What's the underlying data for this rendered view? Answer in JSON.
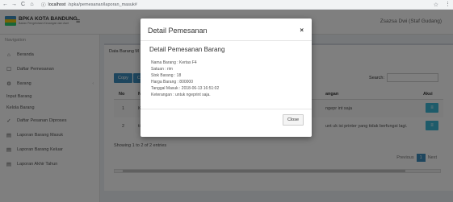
{
  "browser": {
    "url_host": "localhost",
    "url_path": "/spka/pemesanan/laporan_masuk#"
  },
  "header": {
    "logo_title": "BPKA KOTA BANDUNG",
    "logo_subtitle": "Badan Pengelolaan Keuangan dan Aset",
    "user": "Zsazsa Dwi (Staf Gudang)"
  },
  "sidebar": {
    "header": "Navigation",
    "items": [
      {
        "label": "Beranda",
        "icon": "home-icon"
      },
      {
        "label": "Daftar Pemesanan",
        "icon": "list-icon"
      },
      {
        "label": "Barang",
        "icon": "box-icon"
      }
    ],
    "sub_items": [
      "Input Barang",
      "Kelola Barang"
    ],
    "items2": [
      {
        "label": "Daftar Pesanan Diproses",
        "icon": "check-icon"
      },
      {
        "label": "Laporan Barang Masuk",
        "icon": "report-icon"
      },
      {
        "label": "Laporan Barang Keluar",
        "icon": "report-icon"
      },
      {
        "label": "Laporan Akhir Tahun",
        "icon": "report-icon"
      }
    ]
  },
  "main": {
    "box_title": "Data Barang M",
    "buttons": [
      "Copy",
      "CS"
    ],
    "search_label": "Search:",
    "columns": {
      "no": "No",
      "nama": "Nam",
      "keterangan": "angan",
      "aksi": "Aksi"
    },
    "rows": [
      {
        "no": "1",
        "nama": "Kert",
        "keterangan": "ngepr int saja"
      },
      {
        "no": "2",
        "nama": "tinta",
        "keterangan": "unt uk isi printer yang tidak berfungsi lagi."
      }
    ],
    "showing": "Showing 1 to 2 of 2 entries",
    "pagination": {
      "previous": "Previous",
      "page": "1",
      "next": "Next"
    }
  },
  "modal": {
    "title": "Detail Pemesanan",
    "close_glyph": "×",
    "subtitle": "Detail Pemesanan Barang",
    "details": [
      "Nama Barang : Kertas F4",
      "Satuan : rim",
      "Stok Barang : 18",
      "Harga Barang : 800000",
      "Tanggal Masuk : 2018-06-13 16:51:02",
      "Keterangan : untuk ngeprint saja."
    ],
    "close_label": "Close"
  }
}
